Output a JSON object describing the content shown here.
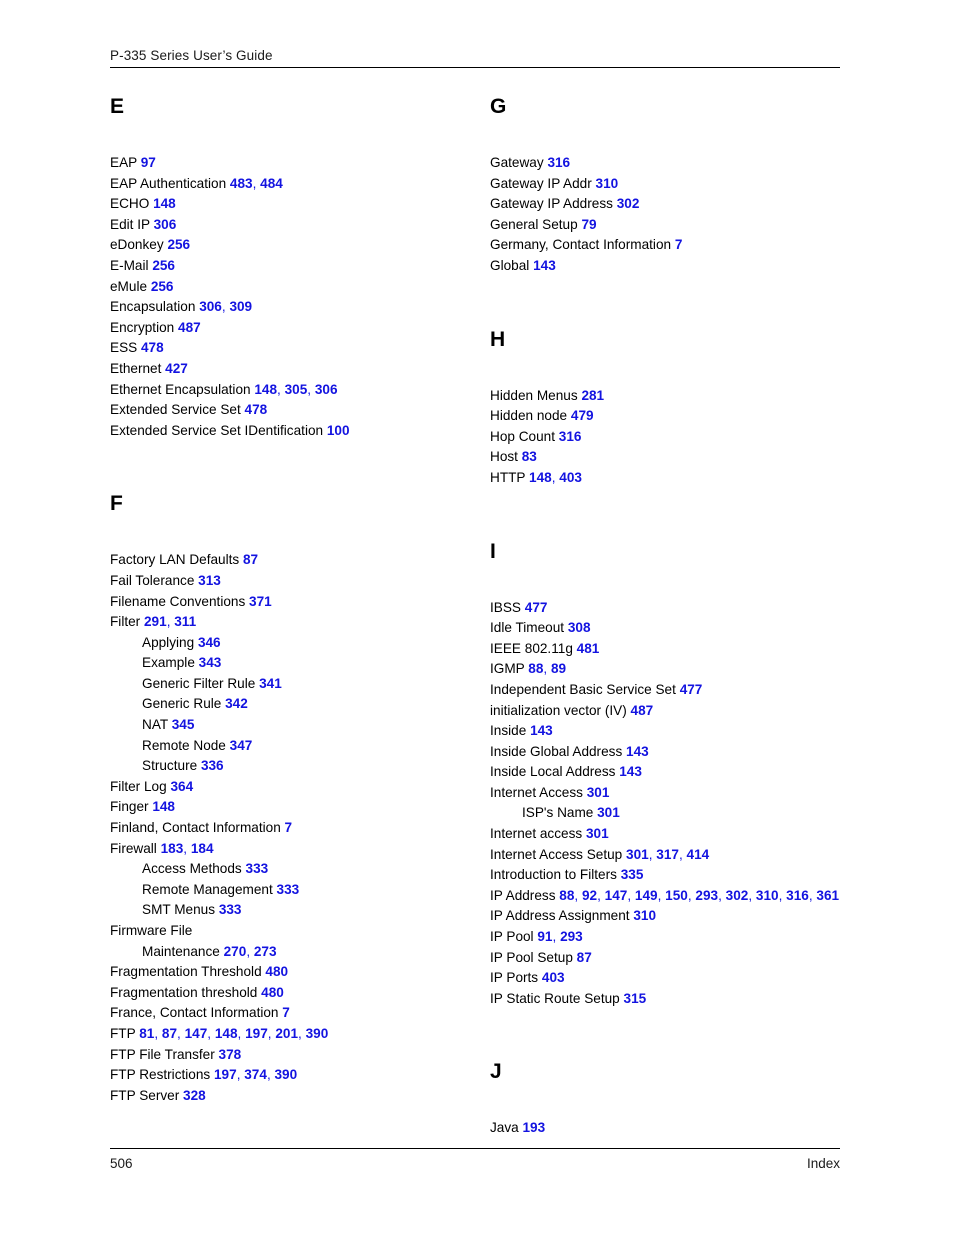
{
  "header": {
    "title": "P-335 Series User’s Guide"
  },
  "footer": {
    "page_number": "506",
    "label": "Index"
  },
  "columns": {
    "left": [
      {
        "letter": "E",
        "entries": [
          {
            "text": "EAP",
            "pages": [
              "97"
            ],
            "sub": false
          },
          {
            "text": "EAP Authentication",
            "pages": [
              "483",
              "484"
            ],
            "sub": false
          },
          {
            "text": "ECHO",
            "pages": [
              "148"
            ],
            "sub": false
          },
          {
            "text": "Edit IP",
            "pages": [
              "306"
            ],
            "sub": false
          },
          {
            "text": "eDonkey",
            "pages": [
              "256"
            ],
            "sub": false
          },
          {
            "text": "E-Mail",
            "pages": [
              "256"
            ],
            "sub": false
          },
          {
            "text": "eMule",
            "pages": [
              "256"
            ],
            "sub": false
          },
          {
            "text": "Encapsulation",
            "pages": [
              "306",
              "309"
            ],
            "sub": false
          },
          {
            "text": "Encryption",
            "pages": [
              "487"
            ],
            "sub": false
          },
          {
            "text": "ESS",
            "pages": [
              "478"
            ],
            "sub": false
          },
          {
            "text": "Ethernet",
            "pages": [
              "427"
            ],
            "sub": false
          },
          {
            "text": "Ethernet Encapsulation",
            "pages": [
              "148",
              "305",
              "306"
            ],
            "sub": false
          },
          {
            "text": "Extended Service Set",
            "pages": [
              "478"
            ],
            "sub": false
          },
          {
            "text": "Extended Service Set IDentification",
            "pages": [
              "100"
            ],
            "sub": false
          }
        ]
      },
      {
        "letter": "F",
        "entries": [
          {
            "text": "Factory LAN Defaults",
            "pages": [
              "87"
            ],
            "sub": false
          },
          {
            "text": "Fail Tolerance",
            "pages": [
              "313"
            ],
            "sub": false
          },
          {
            "text": "Filename Conventions",
            "pages": [
              "371"
            ],
            "sub": false
          },
          {
            "text": "Filter",
            "pages": [
              "291",
              "311"
            ],
            "sub": false
          },
          {
            "text": "Applying",
            "pages": [
              "346"
            ],
            "sub": true
          },
          {
            "text": "Example",
            "pages": [
              "343"
            ],
            "sub": true
          },
          {
            "text": "Generic Filter Rule",
            "pages": [
              "341"
            ],
            "sub": true
          },
          {
            "text": "Generic Rule",
            "pages": [
              "342"
            ],
            "sub": true
          },
          {
            "text": "NAT",
            "pages": [
              "345"
            ],
            "sub": true
          },
          {
            "text": "Remote Node",
            "pages": [
              "347"
            ],
            "sub": true
          },
          {
            "text": "Structure",
            "pages": [
              "336"
            ],
            "sub": true
          },
          {
            "text": "Filter Log",
            "pages": [
              "364"
            ],
            "sub": false
          },
          {
            "text": "Finger",
            "pages": [
              "148"
            ],
            "sub": false
          },
          {
            "text": "Finland, Contact Information",
            "pages": [
              "7"
            ],
            "sub": false
          },
          {
            "text": "Firewall",
            "pages": [
              "183",
              "184"
            ],
            "sub": false
          },
          {
            "text": "Access Methods",
            "pages": [
              "333"
            ],
            "sub": true
          },
          {
            "text": "Remote Management",
            "pages": [
              "333"
            ],
            "sub": true
          },
          {
            "text": "SMT Menus",
            "pages": [
              "333"
            ],
            "sub": true
          },
          {
            "text": "Firmware File",
            "pages": [],
            "sub": false
          },
          {
            "text": "Maintenance",
            "pages": [
              "270",
              "273"
            ],
            "sub": true
          },
          {
            "text": "Fragmentation Threshold",
            "pages": [
              "480"
            ],
            "sub": false
          },
          {
            "text": "Fragmentation threshold",
            "pages": [
              "480"
            ],
            "sub": false
          },
          {
            "text": "France, Contact Information",
            "pages": [
              "7"
            ],
            "sub": false
          },
          {
            "text": "FTP",
            "pages": [
              "81",
              "87",
              "147",
              "148",
              "197",
              "201",
              "390"
            ],
            "sub": false
          },
          {
            "text": "FTP File Transfer",
            "pages": [
              "378"
            ],
            "sub": false
          },
          {
            "text": "FTP Restrictions",
            "pages": [
              "197",
              "374",
              "390"
            ],
            "sub": false
          },
          {
            "text": "FTP Server",
            "pages": [
              "328"
            ],
            "sub": false
          }
        ]
      }
    ],
    "right": [
      {
        "letter": "G",
        "entries": [
          {
            "text": "Gateway",
            "pages": [
              "316"
            ],
            "sub": false
          },
          {
            "text": "Gateway IP Addr",
            "pages": [
              "310"
            ],
            "sub": false
          },
          {
            "text": "Gateway IP Address",
            "pages": [
              "302"
            ],
            "sub": false
          },
          {
            "text": "General Setup",
            "pages": [
              "79"
            ],
            "sub": false
          },
          {
            "text": "Germany, Contact Information",
            "pages": [
              "7"
            ],
            "sub": false
          },
          {
            "text": "Global",
            "pages": [
              "143"
            ],
            "sub": false
          }
        ]
      },
      {
        "letter": "H",
        "entries": [
          {
            "text": "Hidden Menus",
            "pages": [
              "281"
            ],
            "sub": false
          },
          {
            "text": "Hidden node",
            "pages": [
              "479"
            ],
            "sub": false
          },
          {
            "text": "Hop Count",
            "pages": [
              "316"
            ],
            "sub": false
          },
          {
            "text": "Host",
            "pages": [
              "83"
            ],
            "sub": false
          },
          {
            "text": "HTTP",
            "pages": [
              "148",
              "403"
            ],
            "sub": false
          }
        ]
      },
      {
        "letter": "I",
        "entries": [
          {
            "text": "IBSS",
            "pages": [
              "477"
            ],
            "sub": false
          },
          {
            "text": "Idle Timeout",
            "pages": [
              "308"
            ],
            "sub": false
          },
          {
            "text": "IEEE 802.11g",
            "pages": [
              "481"
            ],
            "sub": false
          },
          {
            "text": "IGMP",
            "pages": [
              "88",
              "89"
            ],
            "sub": false
          },
          {
            "text": "Independent Basic Service Set",
            "pages": [
              "477"
            ],
            "sub": false
          },
          {
            "text": "initialization vector (IV)",
            "pages": [
              "487"
            ],
            "sub": false
          },
          {
            "text": "Inside",
            "pages": [
              "143"
            ],
            "sub": false
          },
          {
            "text": "Inside Global Address",
            "pages": [
              "143"
            ],
            "sub": false
          },
          {
            "text": "Inside Local Address",
            "pages": [
              "143"
            ],
            "sub": false
          },
          {
            "text": "Internet Access",
            "pages": [
              "301"
            ],
            "sub": false
          },
          {
            "text": "ISP's Name",
            "pages": [
              "301"
            ],
            "sub": true
          },
          {
            "text": "Internet access",
            "pages": [
              "301"
            ],
            "sub": false
          },
          {
            "text": "Internet Access Setup",
            "pages": [
              "301",
              "317",
              "414"
            ],
            "sub": false
          },
          {
            "text": "Introduction to Filters",
            "pages": [
              "335"
            ],
            "sub": false
          },
          {
            "text": "IP Address",
            "pages": [
              "88",
              "92",
              "147",
              "149",
              "150",
              "293",
              "302",
              "310",
              "316",
              "361"
            ],
            "sub": false
          },
          {
            "text": "IP Address Assignment",
            "pages": [
              "310"
            ],
            "sub": false
          },
          {
            "text": "IP Pool",
            "pages": [
              "91",
              "293"
            ],
            "sub": false
          },
          {
            "text": "IP Pool Setup",
            "pages": [
              "87"
            ],
            "sub": false
          },
          {
            "text": "IP Ports",
            "pages": [
              "403"
            ],
            "sub": false
          },
          {
            "text": "IP Static Route Setup",
            "pages": [
              "315"
            ],
            "sub": false
          }
        ]
      },
      {
        "letter": "J",
        "entries": [
          {
            "text": "Java",
            "pages": [
              "193"
            ],
            "sub": false
          }
        ]
      }
    ]
  },
  "colors": {
    "page_number_blue": "#1313e0",
    "text_black": "#000000"
  }
}
